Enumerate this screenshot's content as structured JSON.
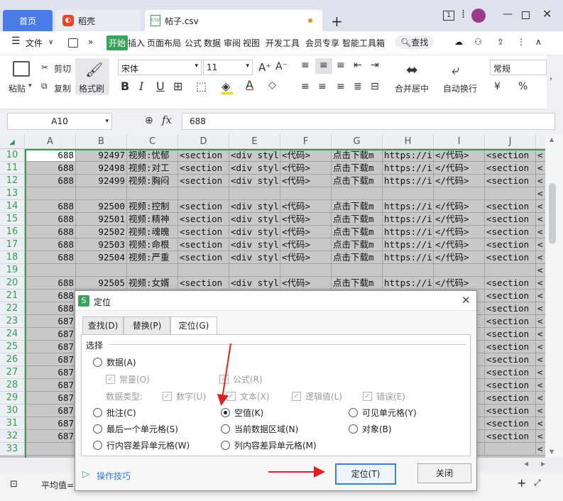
{
  "titlebar": {
    "tabs": {
      "home": "首页",
      "daoke": "稻壳",
      "file": "帖子.csv",
      "csv_badge": "CSV"
    },
    "window_number": "1",
    "accent": "#4a7ce8"
  },
  "menu": {
    "file": "文件",
    "items": [
      "开始",
      "插入",
      "页面布局",
      "公式",
      "数据",
      "审阅",
      "视图",
      "开发工具",
      "会员专享",
      "智能工具箱"
    ],
    "search": "查找"
  },
  "ribbon": {
    "paste": "粘贴",
    "cut": "剪切",
    "copy": "复制",
    "format_painter": "格式刷",
    "font_name": "宋体",
    "font_size": "11",
    "merge": "合并居中",
    "wrap": "自动换行",
    "number_format": "常规",
    "currency": "¥",
    "percent": "%"
  },
  "formula_bar": {
    "cell_ref": "A10",
    "fx": "fx",
    "value": "688"
  },
  "grid": {
    "columns": [
      "A",
      "B",
      "C",
      "D",
      "E",
      "F",
      "G",
      "H",
      "I",
      "J"
    ],
    "rows": [
      {
        "n": "10",
        "cells": [
          "688",
          "92497",
          "视频:忧郁",
          "<section",
          "<div styl",
          "<代码>",
          "点击下载m",
          "https://i",
          "</代码>",
          "<section"
        ]
      },
      {
        "n": "11",
        "cells": [
          "688",
          "92498",
          "视频:对工",
          "<section",
          "<div styl",
          "<代码>",
          "点击下载m",
          "https://i",
          "</代码>",
          "<section"
        ]
      },
      {
        "n": "12",
        "cells": [
          "688",
          "92499",
          "视频:胸闷",
          "<section",
          "<div styl",
          "<代码>",
          "点击下载m",
          "https://i",
          "</代码>",
          "<section"
        ]
      },
      {
        "n": "13",
        "cells": [
          "",
          "",
          "",
          "",
          "",
          "",
          "",
          "",
          "",
          ""
        ]
      },
      {
        "n": "14",
        "cells": [
          "688",
          "92500",
          "视频:控制",
          "<section",
          "<div styl",
          "<代码>",
          "点击下载m",
          "https://i",
          "</代码>",
          "<section"
        ]
      },
      {
        "n": "15",
        "cells": [
          "688",
          "92501",
          "视频:精神",
          "<section",
          "<div styl",
          "<代码>",
          "点击下载m",
          "https://i",
          "</代码>",
          "<section"
        ]
      },
      {
        "n": "16",
        "cells": [
          "688",
          "92502",
          "视频:魂魄",
          "<section",
          "<div styl",
          "<代码>",
          "点击下载m",
          "https://i",
          "</代码>",
          "<section"
        ]
      },
      {
        "n": "17",
        "cells": [
          "688",
          "92503",
          "视频:命根",
          "<section",
          "<div styl",
          "<代码>",
          "点击下载m",
          "https://i",
          "</代码>",
          "<section"
        ]
      },
      {
        "n": "18",
        "cells": [
          "688",
          "92504",
          "视频:严重",
          "<section",
          "<div styl",
          "<代码>",
          "点击下载m",
          "https://i",
          "</代码>",
          "<section"
        ]
      },
      {
        "n": "19",
        "cells": [
          "",
          "",
          "",
          "",
          "",
          "",
          "",
          "",
          "",
          ""
        ]
      },
      {
        "n": "20",
        "cells": [
          "688",
          "92505",
          "视频:女婿",
          "<section",
          "<div styl",
          "<代码>",
          "点击下载m",
          "https://i",
          "</代码>",
          "<section"
        ]
      },
      {
        "n": "21",
        "cells": [
          "688",
          "",
          "",
          "",
          "",
          "",
          "",
          "",
          "",
          "<section"
        ]
      },
      {
        "n": "22",
        "cells": [
          "688",
          "",
          "",
          "",
          "",
          "",
          "",
          "",
          "",
          "<section"
        ]
      },
      {
        "n": "23",
        "cells": [
          "687",
          "",
          "",
          "",
          "",
          "",
          "",
          "",
          "",
          "<section"
        ]
      },
      {
        "n": "24",
        "cells": [
          "687",
          "",
          "",
          "",
          "",
          "",
          "",
          "",
          "",
          "<section"
        ]
      },
      {
        "n": "25",
        "cells": [
          "687",
          "",
          "",
          "",
          "",
          "",
          "",
          "",
          "",
          "<section"
        ]
      },
      {
        "n": "26",
        "cells": [
          "687",
          "",
          "",
          "",
          "",
          "",
          "",
          "",
          "",
          "<section"
        ]
      },
      {
        "n": "27",
        "cells": [
          "687",
          "",
          "",
          "",
          "",
          "",
          "",
          "",
          "",
          "<section"
        ]
      },
      {
        "n": "28",
        "cells": [
          "687",
          "",
          "",
          "",
          "",
          "",
          "",
          "",
          "",
          "<section"
        ]
      },
      {
        "n": "29",
        "cells": [
          "687",
          "",
          "",
          "",
          "",
          "",
          "",
          "",
          "",
          "<section"
        ]
      },
      {
        "n": "30",
        "cells": [
          "687",
          "",
          "",
          "",
          "",
          "",
          "",
          "",
          "",
          "<section"
        ]
      },
      {
        "n": "31",
        "cells": [
          "687",
          "",
          "",
          "",
          "",
          "",
          "",
          "",
          "",
          "<section"
        ]
      },
      {
        "n": "32",
        "cells": [
          "687",
          "",
          "",
          "",
          "",
          "",
          "",
          "",
          "",
          "<section"
        ]
      },
      {
        "n": "33",
        "cells": [
          "",
          "",
          "",
          "",
          "",
          "",
          "",
          "",
          "",
          ""
        ]
      }
    ]
  },
  "status": {
    "avg_label": "平均值="
  },
  "dialog": {
    "title": "定位",
    "tabs": [
      "查找(D)",
      "替换(P)",
      "定位(G)"
    ],
    "group_label": "选择",
    "data": "数据(A)",
    "constant": "常量(O)",
    "formula": "公式(R)",
    "data_type_label": "数据类型:",
    "number": "数字(U)",
    "text": "文本(X)",
    "logical": "逻辑值(L)",
    "error": "错误(E)",
    "comment": "批注(C)",
    "blank": "空值(K)",
    "visible": "可见单元格(Y)",
    "last_cell": "最后一个单元格(S)",
    "current_region": "当前数据区域(N)",
    "objects": "对象(B)",
    "row_diff": "行内容差异单元格(W)",
    "col_diff": "列内容差异单元格(M)",
    "tips": "操作技巧",
    "locate_button": "定位(T)",
    "close_button": "关闭",
    "selected_option": "空值(K)",
    "arrow_color": "#e02020"
  }
}
